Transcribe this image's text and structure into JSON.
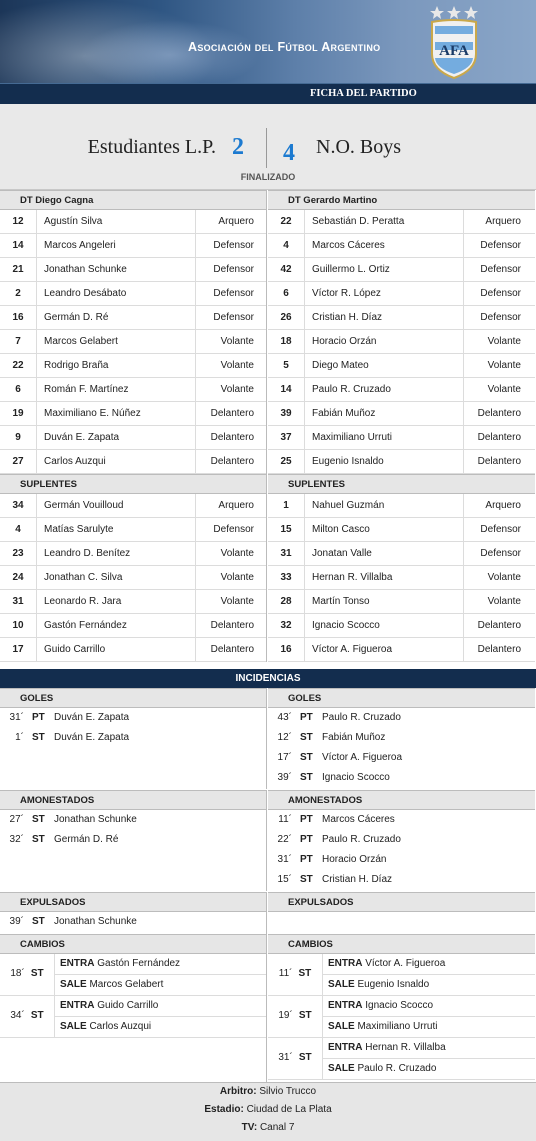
{
  "header": {
    "association": "Asociación del Fútbol Argentino",
    "section_title": "FICHA DEL PARTIDO",
    "logo_text": "AFA"
  },
  "match": {
    "home_team": "Estudiantes L.P.",
    "home_score": "2",
    "away_score": "4",
    "away_team": "N.O. Boys",
    "status": "FINALIZADO"
  },
  "home": {
    "coach": "DT Diego Cagna",
    "starters": [
      {
        "num": "12",
        "name": "Agustín Silva",
        "pos": "Arquero"
      },
      {
        "num": "14",
        "name": "Marcos Angeleri",
        "pos": "Defensor"
      },
      {
        "num": "21",
        "name": "Jonathan Schunke",
        "pos": "Defensor"
      },
      {
        "num": "2",
        "name": "Leandro Desábato",
        "pos": "Defensor"
      },
      {
        "num": "16",
        "name": "Germán D. Ré",
        "pos": "Defensor"
      },
      {
        "num": "7",
        "name": "Marcos Gelabert",
        "pos": "Volante"
      },
      {
        "num": "22",
        "name": "Rodrigo Braña",
        "pos": "Volante"
      },
      {
        "num": "6",
        "name": "Román F. Martínez",
        "pos": "Volante"
      },
      {
        "num": "19",
        "name": "Maximiliano E. Núñez",
        "pos": "Delantero"
      },
      {
        "num": "9",
        "name": "Duván E. Zapata",
        "pos": "Delantero"
      },
      {
        "num": "27",
        "name": "Carlos Auzqui",
        "pos": "Delantero"
      }
    ],
    "subs_label": "SUPLENTES",
    "subs": [
      {
        "num": "34",
        "name": "Germán Vouilloud",
        "pos": "Arquero"
      },
      {
        "num": "4",
        "name": "Matías Sarulyte",
        "pos": "Defensor"
      },
      {
        "num": "23",
        "name": "Leandro D. Benítez",
        "pos": "Volante"
      },
      {
        "num": "24",
        "name": "Jonathan C. Silva",
        "pos": "Volante"
      },
      {
        "num": "31",
        "name": "Leonardo R. Jara",
        "pos": "Volante"
      },
      {
        "num": "10",
        "name": "Gastón Fernández",
        "pos": "Delantero"
      },
      {
        "num": "17",
        "name": "Guido Carrillo",
        "pos": "Delantero"
      }
    ]
  },
  "away": {
    "coach": "DT Gerardo Martino",
    "starters": [
      {
        "num": "22",
        "name": "Sebastián D. Peratta",
        "pos": "Arquero"
      },
      {
        "num": "4",
        "name": "Marcos Cáceres",
        "pos": "Defensor"
      },
      {
        "num": "42",
        "name": "Guillermo L. Ortiz",
        "pos": "Defensor"
      },
      {
        "num": "6",
        "name": "Víctor R. López",
        "pos": "Defensor"
      },
      {
        "num": "26",
        "name": "Cristian H. Díaz",
        "pos": "Defensor"
      },
      {
        "num": "18",
        "name": "Horacio Orzán",
        "pos": "Volante"
      },
      {
        "num": "5",
        "name": "Diego Mateo",
        "pos": "Volante"
      },
      {
        "num": "14",
        "name": "Paulo R. Cruzado",
        "pos": "Volante"
      },
      {
        "num": "39",
        "name": "Fabián Muñoz",
        "pos": "Delantero"
      },
      {
        "num": "37",
        "name": "Maximiliano Urruti",
        "pos": "Delantero"
      },
      {
        "num": "25",
        "name": "Eugenio Isnaldo",
        "pos": "Delantero"
      }
    ],
    "subs_label": "SUPLENTES",
    "subs": [
      {
        "num": "1",
        "name": "Nahuel Guzmán",
        "pos": "Arquero"
      },
      {
        "num": "15",
        "name": "Milton Casco",
        "pos": "Defensor"
      },
      {
        "num": "31",
        "name": "Jonatan Valle",
        "pos": "Defensor"
      },
      {
        "num": "33",
        "name": "Hernan R. Villalba",
        "pos": "Volante"
      },
      {
        "num": "28",
        "name": "Martín Tonso",
        "pos": "Volante"
      },
      {
        "num": "32",
        "name": "Ignacio Scocco",
        "pos": "Delantero"
      },
      {
        "num": "16",
        "name": "Víctor A. Figueroa",
        "pos": "Delantero"
      }
    ]
  },
  "incidences": {
    "title": "INCIDENCIAS",
    "labels": {
      "goals": "GOLES",
      "cards": "AMONESTADOS",
      "expelled": "EXPULSADOS",
      "changes": "CAMBIOS",
      "in": "ENTRA",
      "out": "SALE"
    },
    "home": {
      "goals": [
        {
          "min": "31´",
          "per": "PT",
          "who": "Duván E. Zapata"
        },
        {
          "min": "1´",
          "per": "ST",
          "who": "Duván E. Zapata"
        }
      ],
      "cards": [
        {
          "min": "27´",
          "per": "ST",
          "who": "Jonathan Schunke"
        },
        {
          "min": "32´",
          "per": "ST",
          "who": "Germán D. Ré"
        }
      ],
      "expelled": [
        {
          "min": "39´",
          "per": "ST",
          "who": "Jonathan Schunke"
        }
      ],
      "changes": [
        {
          "min": "18´",
          "per": "ST",
          "in": "Gastón Fernández",
          "out": "Marcos Gelabert"
        },
        {
          "min": "34´",
          "per": "ST",
          "in": "Guido Carrillo",
          "out": "Carlos Auzqui"
        }
      ]
    },
    "away": {
      "goals": [
        {
          "min": "43´",
          "per": "PT",
          "who": "Paulo R. Cruzado"
        },
        {
          "min": "12´",
          "per": "ST",
          "who": "Fabián Muñoz"
        },
        {
          "min": "17´",
          "per": "ST",
          "who": "Víctor A. Figueroa"
        },
        {
          "min": "39´",
          "per": "ST",
          "who": "Ignacio Scocco"
        }
      ],
      "cards": [
        {
          "min": "11´",
          "per": "PT",
          "who": "Marcos Cáceres"
        },
        {
          "min": "22´",
          "per": "PT",
          "who": "Paulo R. Cruzado"
        },
        {
          "min": "31´",
          "per": "PT",
          "who": "Horacio Orzán"
        },
        {
          "min": "15´",
          "per": "ST",
          "who": "Cristian H. Díaz"
        }
      ],
      "expelled": [],
      "changes": [
        {
          "min": "11´",
          "per": "ST",
          "in": "Víctor A. Figueroa",
          "out": "Eugenio Isnaldo"
        },
        {
          "min": "19´",
          "per": "ST",
          "in": "Ignacio Scocco",
          "out": "Maximiliano Urruti"
        },
        {
          "min": "31´",
          "per": "ST",
          "in": "Hernan R. Villalba",
          "out": "Paulo R. Cruzado"
        }
      ]
    }
  },
  "footer": {
    "referee_label": "Arbitro:",
    "referee": "Silvio Trucco",
    "stadium_label": "Estadio:",
    "stadium": "Ciudad de La Plata",
    "tv_label": "TV:",
    "tv": "Canal 7"
  },
  "colors": {
    "navy": "#132d4e",
    "score_blue": "#1c7ad0"
  }
}
